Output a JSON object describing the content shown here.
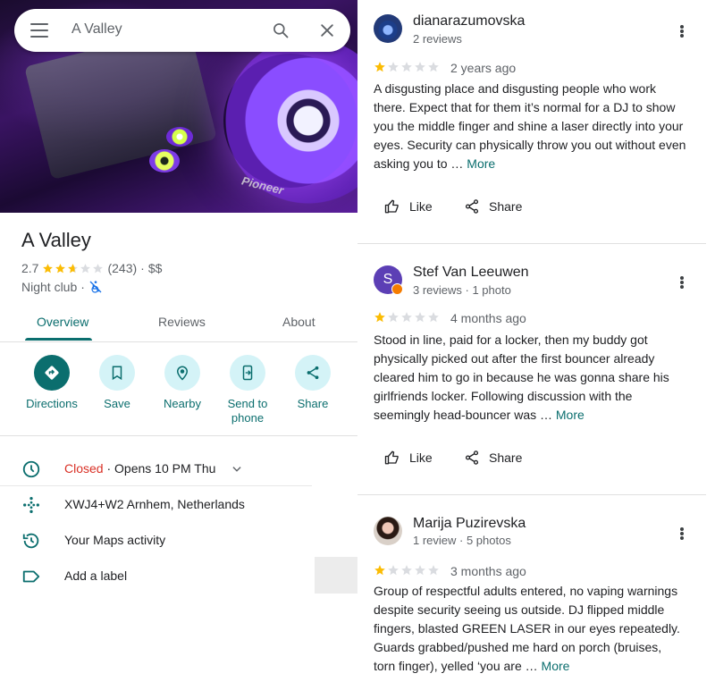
{
  "search": {
    "query": "A Valley"
  },
  "hero": {
    "logo_text": "Pioneer"
  },
  "place": {
    "name": "A Valley",
    "rating": "2.7",
    "rating_value": 2.7,
    "review_count": "(243)",
    "price_sep": "·",
    "price": "$$",
    "category": "Night club",
    "category_sep": "·"
  },
  "tabs": [
    {
      "label": "Overview",
      "active": true
    },
    {
      "label": "Reviews",
      "active": false
    },
    {
      "label": "About",
      "active": false
    }
  ],
  "actions": [
    {
      "label": "Directions",
      "icon": "directions-icon"
    },
    {
      "label": "Save",
      "icon": "bookmark-icon"
    },
    {
      "label": "Nearby",
      "icon": "nearby-icon"
    },
    {
      "label": "Send to phone",
      "icon": "send-to-phone-icon"
    },
    {
      "label": "Share",
      "icon": "share-icon"
    }
  ],
  "info": {
    "hours_status": "Closed",
    "hours_detail": " · Opens 10 PM Thu",
    "plus_code": "XWJ4+W2 Arnhem, Netherlands",
    "maps_activity": "Your Maps activity",
    "add_label": "Add a label"
  },
  "reviews": [
    {
      "name": "dianarazumovska",
      "meta": "2 reviews",
      "stars": 1,
      "date": "2 years ago",
      "text": "A disgusting place and disgusting people who work there. Expect that for them it’s normal for a DJ to show you the middle finger and shine a laser directly into your eyes. Security can physically throw you out without even asking you to … ",
      "more": "More",
      "like": "Like",
      "share": "Share"
    },
    {
      "name": "Stef Van Leeuwen",
      "meta": "3 reviews · 1 photo",
      "avatar_letter": "S",
      "stars": 1,
      "date": "4 months ago",
      "text": "Stood in line, paid for a locker, then my buddy got physically picked out after the first bouncer already cleared him to go in because he was gonna share his girlfriends locker. Following discussion with the seemingly head-bouncer was … ",
      "more": "More",
      "like": "Like",
      "share": "Share"
    },
    {
      "name": "Marija Puzirevska",
      "meta": "1 review · 5 photos",
      "stars": 1,
      "date": "3 months ago",
      "text": "Group of respectful adults entered, no vaping warnings despite security seeing us outside. DJ flipped middle fingers, blasted GREEN LASER in our eyes repeatedly. Guards grabbed/pushed me hard on porch (bruises, torn finger), yelled ‘you are … ",
      "more": "More"
    }
  ],
  "colors": {
    "accent": "#0b6e6e",
    "action_bg": "#d4f3f7",
    "star": "#fbbc04",
    "closed": "#d93025",
    "stef_avatar": "#5c3fb5"
  }
}
